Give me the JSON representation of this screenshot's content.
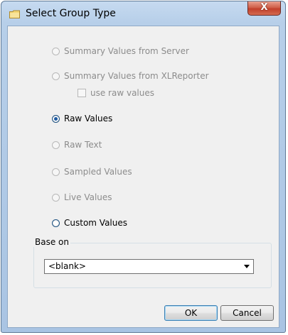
{
  "window": {
    "title": "Select Group Type",
    "close_symbol": "X"
  },
  "options": [
    {
      "label": "Summary Values from Server",
      "enabled": false,
      "checked": false
    },
    {
      "label": "Summary Values from XLReporter",
      "enabled": false,
      "checked": false
    },
    {
      "label": "Raw Values",
      "enabled": true,
      "checked": true
    },
    {
      "label": "Raw Text",
      "enabled": false,
      "checked": false
    },
    {
      "label": "Sampled Values",
      "enabled": false,
      "checked": false
    },
    {
      "label": "Live Values",
      "enabled": false,
      "checked": false
    },
    {
      "label": "Custom Values",
      "enabled": true,
      "checked": false
    }
  ],
  "raw_values_checkbox": {
    "label": "use raw values",
    "checked": false,
    "enabled": false
  },
  "base_on": {
    "title": "Base on",
    "selected": "<blank>"
  },
  "buttons": {
    "ok": "OK",
    "cancel": "Cancel"
  },
  "icons": {
    "title_icon": "folder-icon",
    "close_icon": "close-icon",
    "dropdown_icon": "chevron-down-icon"
  }
}
